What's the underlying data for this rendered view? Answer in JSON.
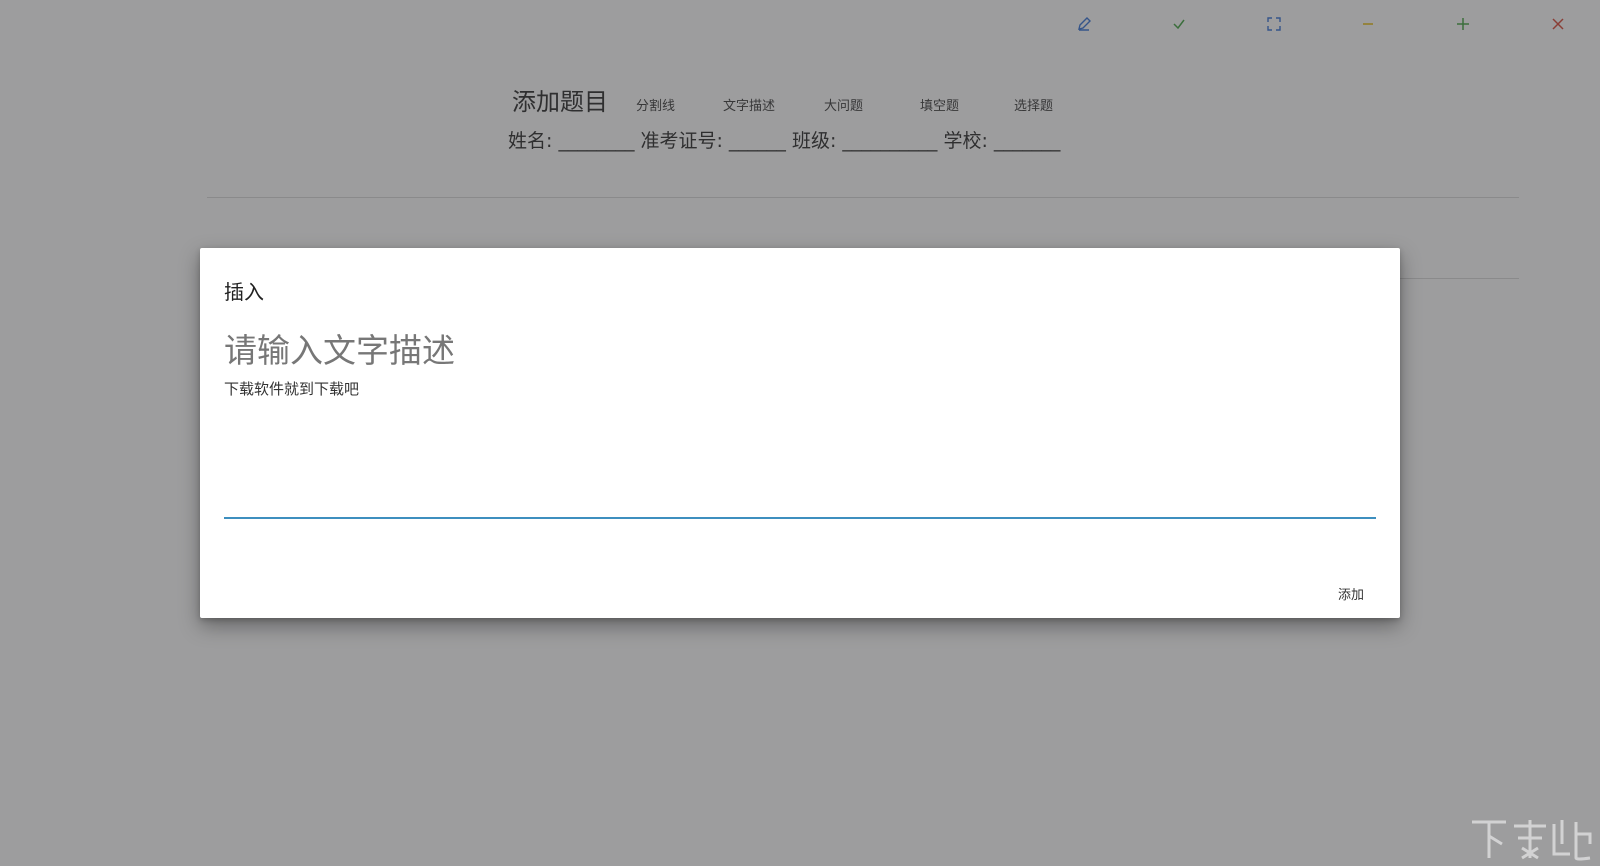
{
  "window_controls": {
    "edit_icon": "pencil-icon",
    "check_icon": "check-icon",
    "fullscreen_icon": "fullscreen-icon",
    "minimize_icon": "minus-icon",
    "add_icon": "plus-icon",
    "close_icon": "close-icon",
    "colors": {
      "edit": "#2f6fd6",
      "check": "#3aa03a",
      "fullscreen": "#2f6fd6",
      "minimize": "#e6b800",
      "add": "#3aa03a",
      "close": "#d9402e"
    }
  },
  "header": {
    "title": "添加题目",
    "tools": [
      "分割线",
      "文字描述",
      "大问题",
      "填空题",
      "选择题"
    ]
  },
  "info_line": "姓名: ________ 准考证号: ______ 班级: __________ 学校: _______",
  "dialog": {
    "title": "插入",
    "placeholder": "请输入文字描述",
    "value": "下载软件就到下载吧",
    "add_label": "添加",
    "accent_color": "#3d8fbf"
  }
}
